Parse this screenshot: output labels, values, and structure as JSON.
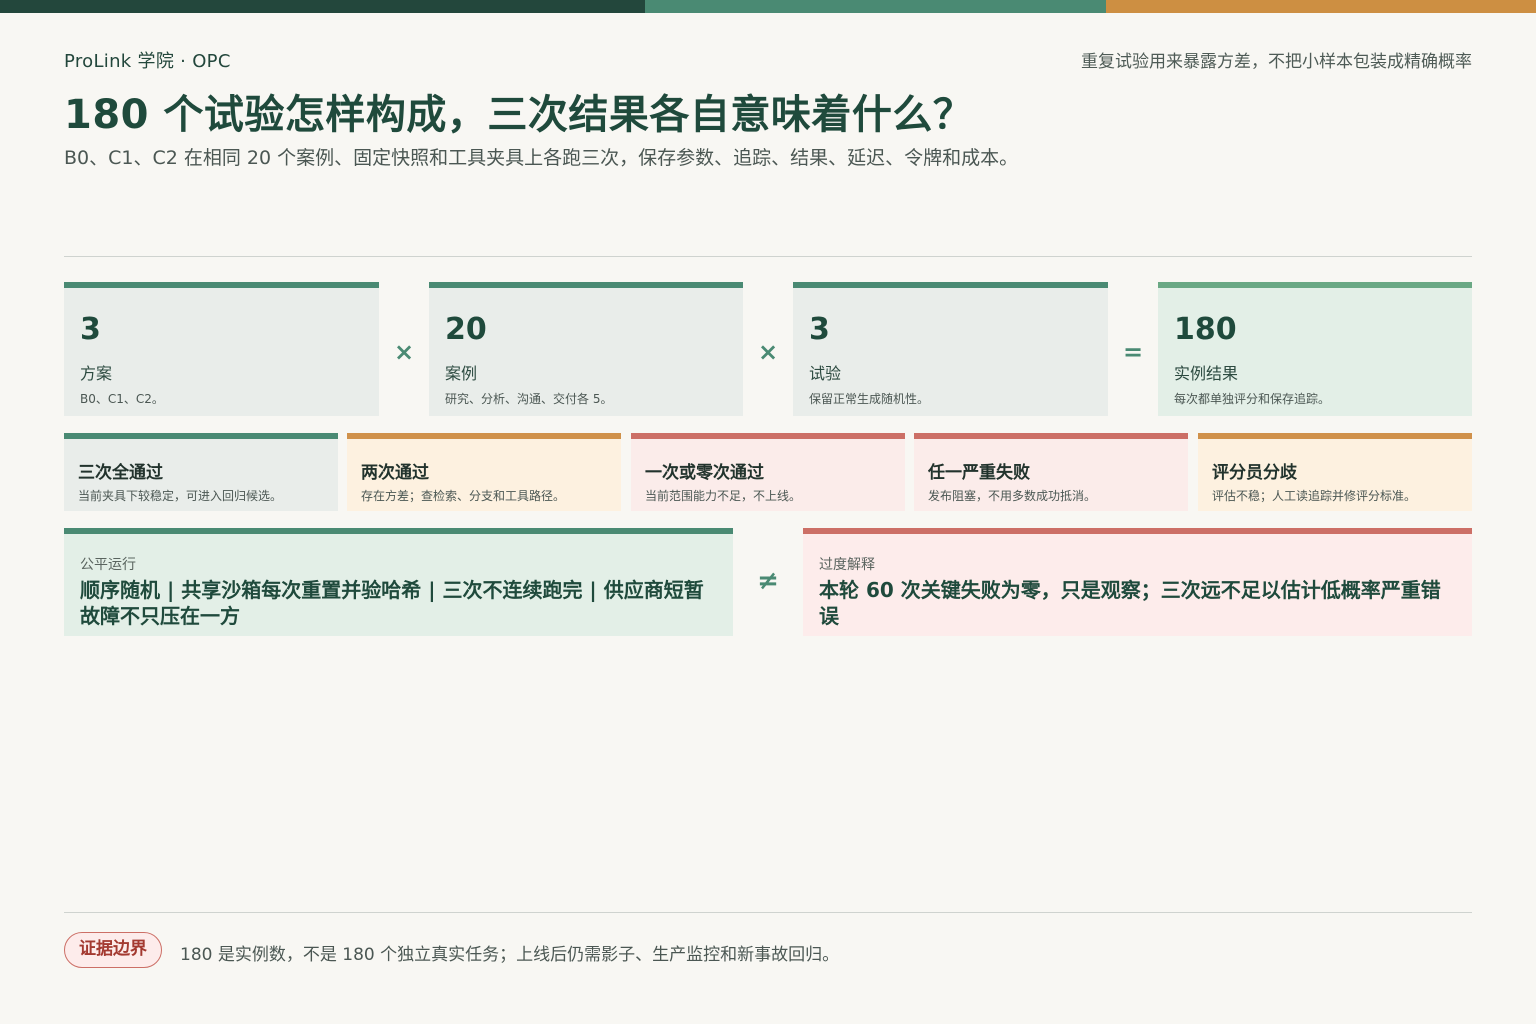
{
  "header": {
    "brand": "ProLink 学院 · OPC",
    "tagline": "重复试验用来暴露方差，不把小样本包装成精确概率",
    "title": "180 个试验怎样构成，三次结果各自意味着什么？",
    "subtitle": "B0、C1、C2 在相同 20 个案例、固定快照和工具夹具上各跑三次，保存参数、追踪、结果、延迟、令牌和成本。"
  },
  "colors": {
    "top_bar": [
      "#23473c",
      "#4a8a73",
      "#cd8f42"
    ],
    "green": "#4a8a73",
    "orange": "#d0914a",
    "red": "#cc6f66"
  },
  "equation": {
    "terms": [
      {
        "value": "3",
        "label": "方案",
        "desc": "B0、C1、C2。"
      },
      {
        "value": "20",
        "label": "案例",
        "desc": "研究、分析、沟通、交付各 5。"
      },
      {
        "value": "3",
        "label": "试验",
        "desc": "保留正常生成随机性。"
      }
    ],
    "operators": [
      "×",
      "×",
      "="
    ],
    "result": {
      "value": "180",
      "label": "实例结果",
      "desc": "每次都单独评分和保存追踪。"
    }
  },
  "outcomes": [
    {
      "title": "三次全通过",
      "desc": "当前夹具下较稳定，可进入回归候选。",
      "tone": "green"
    },
    {
      "title": "两次通过",
      "desc": "存在方差；查检索、分支和工具路径。",
      "tone": "orange"
    },
    {
      "title": "一次或零次通过",
      "desc": "当前范围能力不足，不上线。",
      "tone": "red"
    },
    {
      "title": "任一严重失败",
      "desc": "发布阻塞，不用多数成功抵消。",
      "tone": "red"
    },
    {
      "title": "评分员分歧",
      "desc": "评估不稳；人工读追踪并修评分标准。",
      "tone": "orange"
    }
  ],
  "comparison": {
    "fair": {
      "label": "公平运行",
      "text": "顺序随机 | 共享沙箱每次重置并验哈希 | 三次不连续跑完 | 供应商短暂故障不只压在一方"
    },
    "operator": "≠",
    "over": {
      "label": "过度解释",
      "text": "本轮 60 次关键失败为零，只是观察；三次远不足以估计低概率严重错误"
    }
  },
  "footer": {
    "badge": "证据边界",
    "note": "180 是实例数，不是 180 个独立真实任务；上线后仍需影子、生产监控和新事故回归。"
  }
}
